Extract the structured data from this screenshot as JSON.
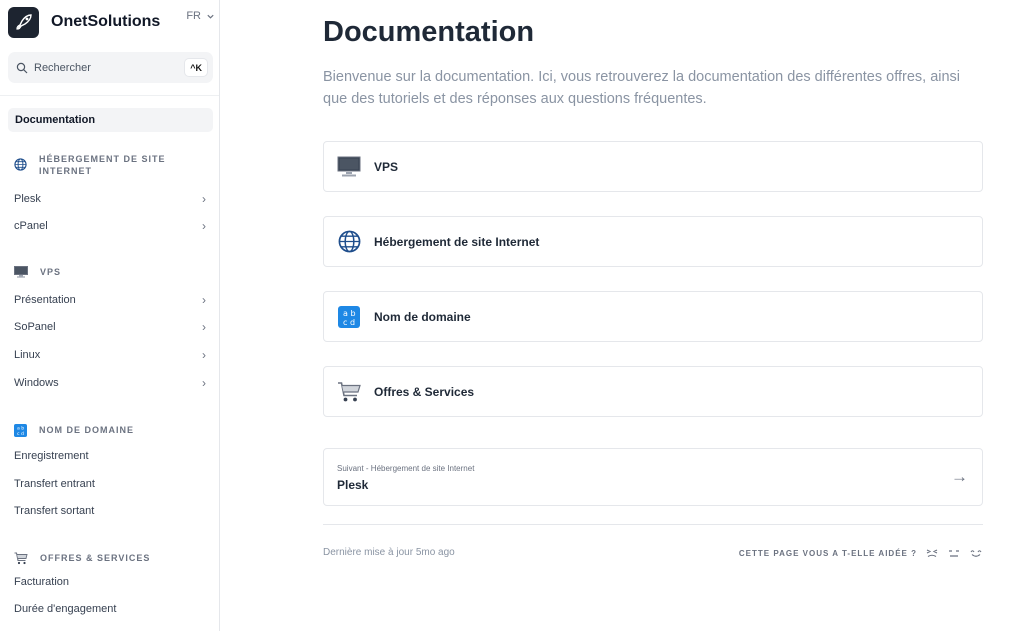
{
  "brand": {
    "name": "OnetSolutions",
    "lang": "FR"
  },
  "search": {
    "placeholder": "Rechercher",
    "shortcut": "^K"
  },
  "sidebar": {
    "active": "Documentation",
    "sections": [
      {
        "title": "HÉBERGEMENT DE SITE INTERNET",
        "icon": "globe-icon",
        "items": [
          {
            "label": "Plesk",
            "chevron": true
          },
          {
            "label": "cPanel",
            "chevron": true
          }
        ]
      },
      {
        "title": "VPS",
        "icon": "monitor-icon",
        "items": [
          {
            "label": "Présentation",
            "chevron": true
          },
          {
            "label": "SoPanel",
            "chevron": true
          },
          {
            "label": "Linux",
            "chevron": true
          },
          {
            "label": "Windows",
            "chevron": true
          }
        ]
      },
      {
        "title": "NOM DE DOMAINE",
        "icon": "abcd-icon",
        "items": [
          {
            "label": "Enregistrement"
          },
          {
            "label": "Transfert entrant"
          },
          {
            "label": "Transfert sortant"
          }
        ]
      },
      {
        "title": "OFFRES & SERVICES",
        "icon": "cart-icon",
        "items": [
          {
            "label": "Facturation"
          },
          {
            "label": "Durée d'engagement"
          }
        ]
      }
    ]
  },
  "main": {
    "title": "Documentation",
    "intro": "Bienvenue sur la documentation. Ici, vous retrouverez la documentation des différentes offres, ainsi que des tutoriels et des réponses aux questions fréquentes.",
    "cards": [
      {
        "label": "VPS",
        "icon": "monitor-icon"
      },
      {
        "label": "Hébergement de site Internet",
        "icon": "globe-icon"
      },
      {
        "label": "Nom de domaine",
        "icon": "abcd-icon"
      },
      {
        "label": "Offres & Services",
        "icon": "cart-icon"
      }
    ],
    "next": {
      "caption": "Suivant - Hébergement de site Internet",
      "title": "Plesk"
    },
    "footer": {
      "updated": "Dernière mise à jour 5mo ago",
      "helpful": "CETTE PAGE VOUS A T-ELLE AIDÉE ?"
    }
  },
  "colors": {
    "text": "#1f2937",
    "muted": "#8a94a3",
    "border": "#e5e7eb",
    "active_bg": "#f3f4f6",
    "abcd_blue": "#1e88e5"
  }
}
